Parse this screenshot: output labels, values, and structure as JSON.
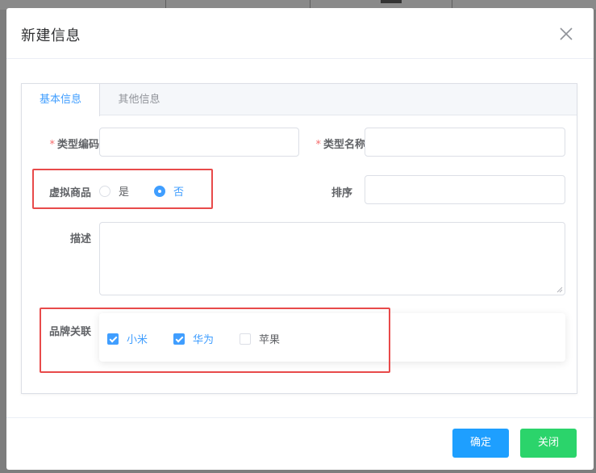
{
  "dialog": {
    "title": "新建信息",
    "close_icon": "close-icon"
  },
  "tabs": [
    {
      "label": "基本信息",
      "active": true
    },
    {
      "label": "其他信息",
      "active": false
    }
  ],
  "form": {
    "type_code": {
      "label": "类型编码",
      "required": true,
      "value": ""
    },
    "type_name": {
      "label": "类型名称",
      "required": true,
      "value": ""
    },
    "virtual_goods": {
      "label": "虚拟商品",
      "options": [
        {
          "label": "是",
          "checked": false
        },
        {
          "label": "否",
          "checked": true
        }
      ]
    },
    "sort": {
      "label": "排序",
      "value": ""
    },
    "description": {
      "label": "描述",
      "value": ""
    },
    "brands": {
      "label": "品牌关联",
      "options": [
        {
          "label": "小米",
          "checked": true
        },
        {
          "label": "华为",
          "checked": true
        },
        {
          "label": "苹果",
          "checked": false
        }
      ]
    }
  },
  "footer": {
    "ok_label": "确定",
    "close_label": "关闭"
  },
  "colors": {
    "primary": "#409eff",
    "ok_button": "#1e9fff",
    "close_button": "#2bd46b",
    "highlight": "#e84a4a"
  }
}
